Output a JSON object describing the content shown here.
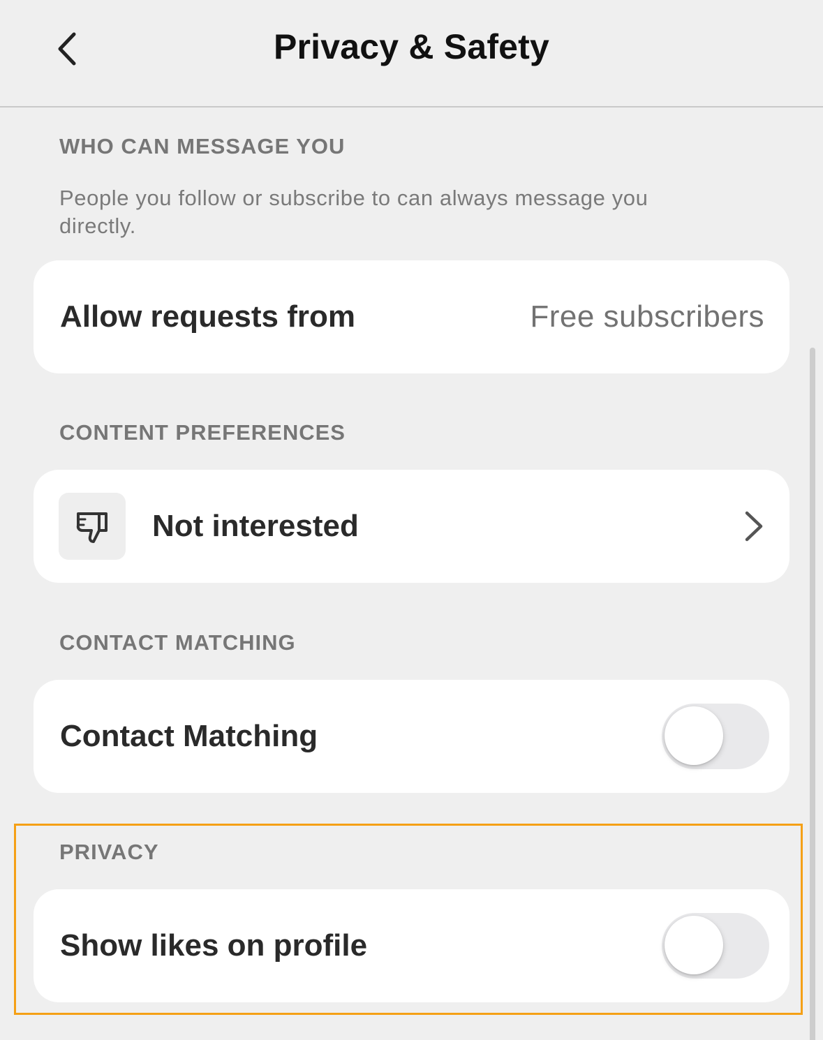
{
  "header": {
    "title": "Privacy & Safety",
    "back_icon": "chevron-left-icon"
  },
  "messaging": {
    "section_title": "WHO CAN MESSAGE YOU",
    "description": "People you follow or subscribe to can always message you directly.",
    "allow_requests_label": "Allow requests from",
    "allow_requests_value": "Free subscribers"
  },
  "content_preferences": {
    "section_title": "CONTENT PREFERENCES",
    "not_interested_label": "Not interested",
    "icon": "thumbs-down-icon"
  },
  "contact_matching": {
    "section_title": "CONTACT MATCHING",
    "label": "Contact Matching",
    "enabled": false
  },
  "privacy": {
    "section_title": "PRIVACY",
    "show_likes_label": "Show likes on profile",
    "enabled": false
  },
  "colors": {
    "background": "#efefef",
    "card": "#ffffff",
    "highlight": "#f5a016",
    "section_text": "#767676"
  }
}
